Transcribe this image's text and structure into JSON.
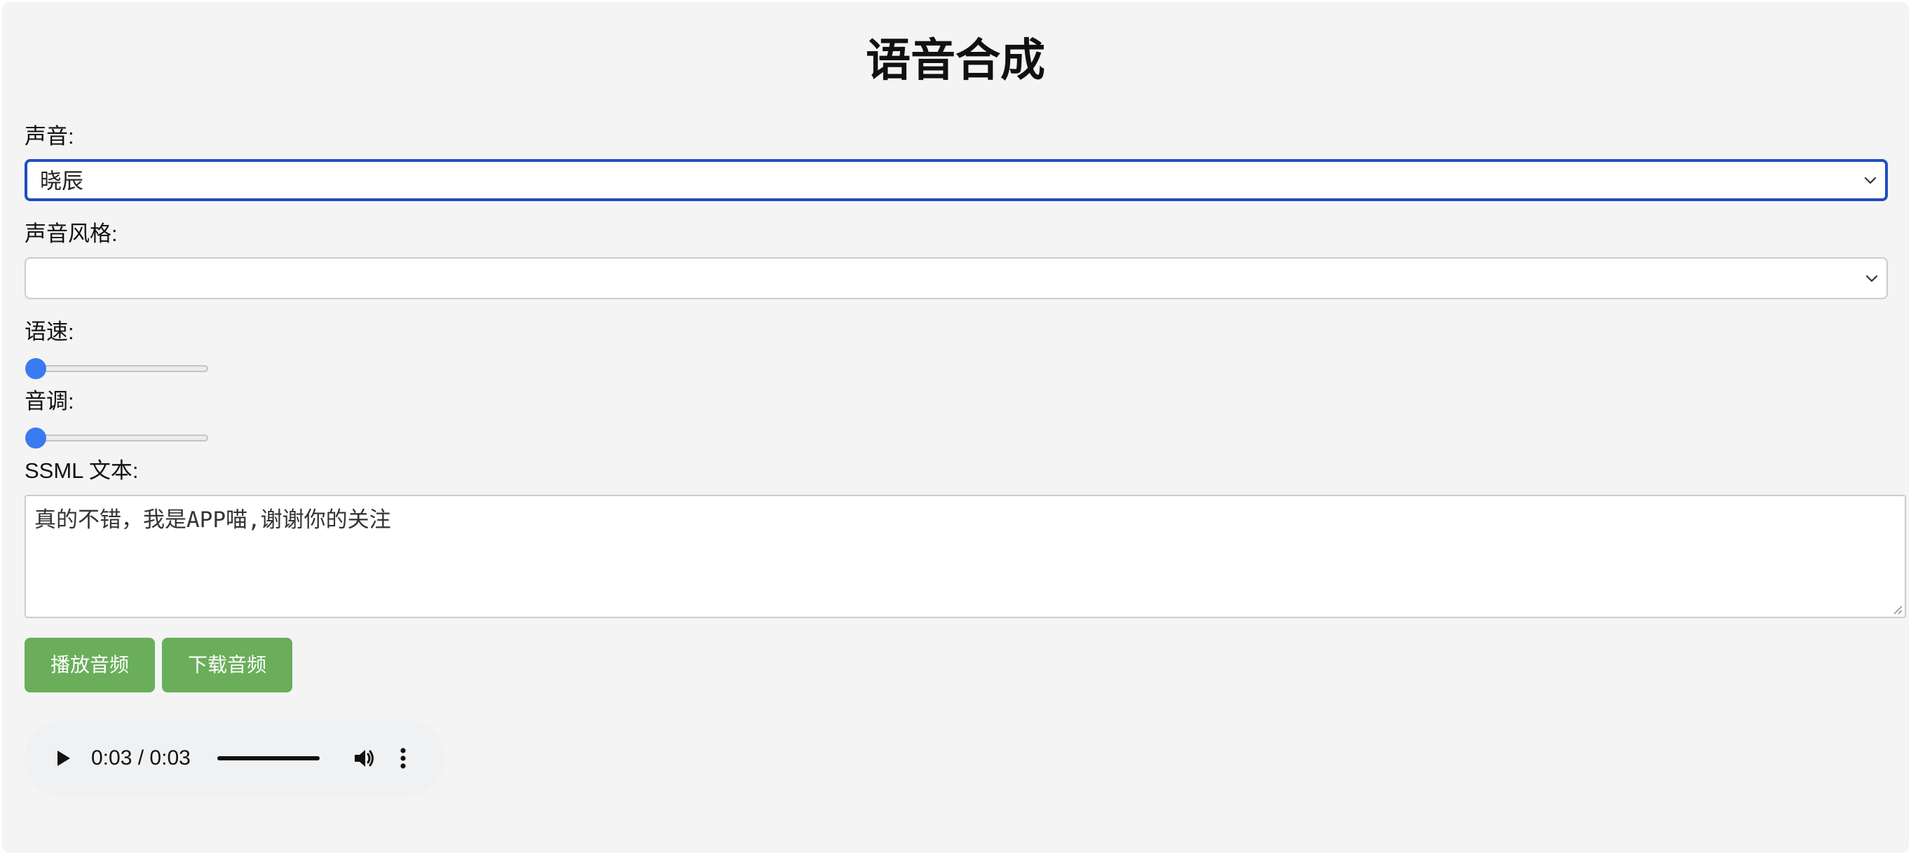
{
  "title": "语音合成",
  "voice": {
    "label": "声音:",
    "selected": "晓辰",
    "icon": "chevron-down-icon"
  },
  "style": {
    "label": "声音风格:",
    "selected": "",
    "icon": "chevron-down-icon"
  },
  "rate": {
    "label": "语速:",
    "level": 0
  },
  "pitch": {
    "label": "音调:",
    "level": 0
  },
  "ssml": {
    "label": "SSML 文本:",
    "value": "真的不错，我是APP喵,谢谢你的关注"
  },
  "buttons": {
    "play": "播放音频",
    "download": "下载音频",
    "color": "#6aae5b"
  },
  "audio": {
    "current": "0:03",
    "separator": "/",
    "duration": "0:03",
    "progress": 1.0,
    "icons": [
      "play-icon",
      "volume-icon",
      "more-options-icon"
    ]
  },
  "colors": {
    "accent": "#3a7bf2",
    "focus_border": "#1f4fbf",
    "background": "#f4f4f4"
  }
}
